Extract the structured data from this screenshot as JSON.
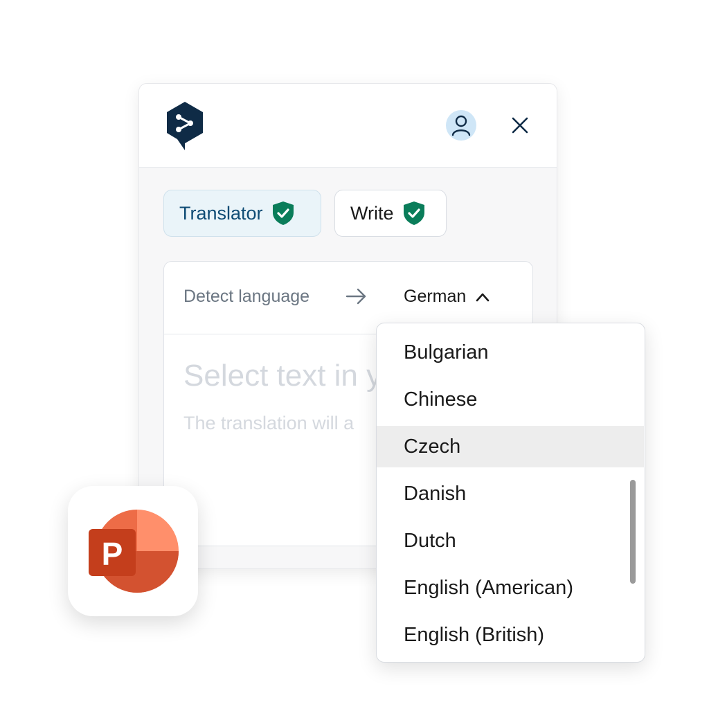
{
  "header": {
    "logo_icon": "deepl-logo-icon",
    "avatar_icon": "user-icon",
    "close_icon": "close-icon"
  },
  "tabs": [
    {
      "label": "Translator",
      "icon": "shield-check-icon",
      "active": true
    },
    {
      "label": "Write",
      "icon": "shield-check-icon",
      "active": false
    }
  ],
  "translator": {
    "source_language": "Detect language",
    "target_language": "German",
    "placeholder_title": "Select text in y",
    "placeholder_subtitle": "The translation will a"
  },
  "dropdown": {
    "items": [
      "Bulgarian",
      "Chinese",
      "Czech",
      "Danish",
      "Dutch",
      "English (American)",
      "English (British)"
    ],
    "selected": "Czech"
  },
  "app_badge": {
    "icon": "powerpoint-icon",
    "letter": "P"
  },
  "colors": {
    "brand_navy": "#0f2b46",
    "accent_blue": "#0f4c75",
    "shield_green": "#0a7d5a",
    "ppt_orange": "#e0552f"
  }
}
